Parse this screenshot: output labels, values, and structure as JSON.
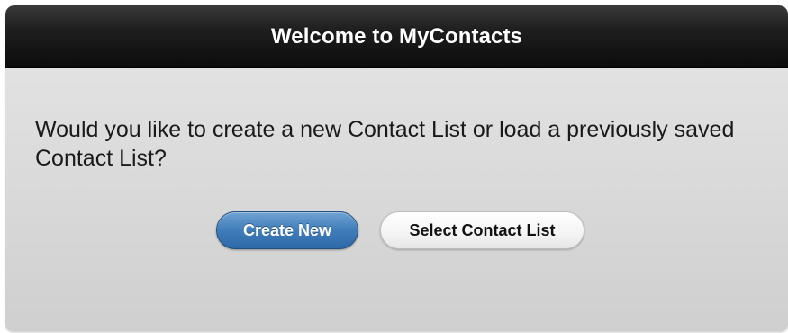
{
  "dialog": {
    "title": "Welcome to MyContacts",
    "message": "Would you like to create a new Contact List or load a previously saved Contact List?",
    "buttons": {
      "create_new": "Create New",
      "select_list": "Select Contact List"
    }
  },
  "colors": {
    "titlebar": "#1a1a1a",
    "primary_button": "#3f7cb8",
    "dialog_background": "#dcdcdc"
  }
}
